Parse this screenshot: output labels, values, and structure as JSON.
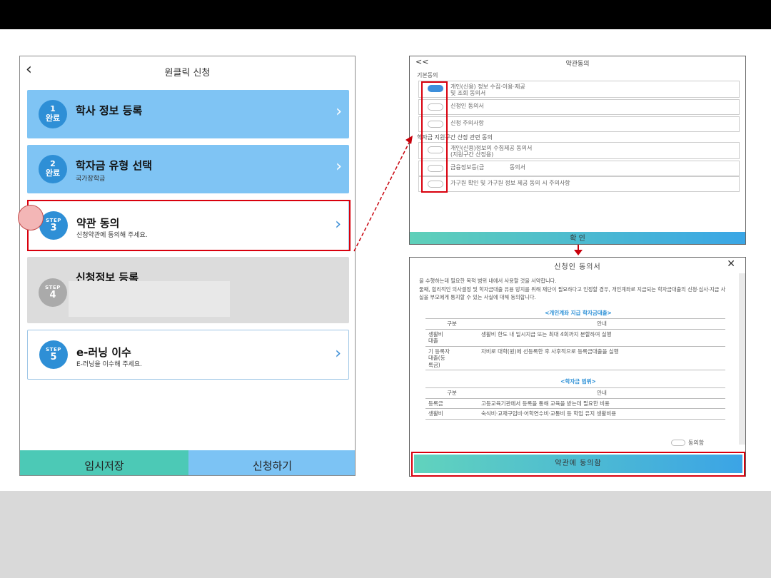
{
  "colors": {
    "highlight": "#d9000d",
    "accent_blue": "#2e8fd6",
    "step_done": "#7fc4f4",
    "teal": "#4cc9b6"
  },
  "phone": {
    "title": "원클릭 신청",
    "steps": [
      {
        "num": "1",
        "tag": "완료",
        "title": "학사 정보 등록",
        "sub": ""
      },
      {
        "num": "2",
        "tag": "완료",
        "title": "학자금 유형 선택",
        "sub": "국가장학금"
      },
      {
        "num": "3",
        "tag": "STEP",
        "title": "약관 동의",
        "sub": "신청약관에 동의해 주세요."
      },
      {
        "num": "4",
        "tag": "STEP",
        "title": "신청정보 등록",
        "sub": ""
      },
      {
        "num": "5",
        "tag": "STEP",
        "title": "e-러닝 이수",
        "sub": "E-러닝을 이수해 주세요."
      }
    ],
    "save_label": "임시저장",
    "apply_label": "신청하기"
  },
  "terms": {
    "back": "<<",
    "title": "약관동의",
    "section1": "기본동의",
    "section2": "학자금 지원구간 산정 관련 동의",
    "items": [
      "개인(신용) 정보 수집·이용·제공\n및 조회 동의서",
      "신청인 동의서",
      "신청 주의사항",
      "개인(신용)정보의 수집제공 동의서\n(지원구간 산정용)",
      "금융정보등(금              동의서",
      "가구원 확인 및 가구원 정보 제공 동의 시 주의사항"
    ],
    "confirm_label": "확 인"
  },
  "consent": {
    "title": "신청인 동의서",
    "para1": "을 수행하는데 필요한 목적 범위 내에서 사용할 것을 서약합니다.",
    "para2": "둘째, 합리적인 의사결정 및 학자금대출 유용 방지를 위해 재단이 필요하다고 인정할 경우, 개인계좌로 지급되는 학자금대출의 신청·심사·지급 사실을 부모에게 통지할 수 있는 사실에 대해 동의합니다.",
    "sub1": "<개인계좌 지급 학자금대출>",
    "table1_head": [
      "구분",
      "안내"
    ],
    "table1": [
      [
        "생활비\n대출",
        "생활비 한도 내 일시지급 또는 최대 4회까지 분할하여 실행"
      ],
      [
        "기 등록자\n대출(등\n록금)",
        "자비로 대학(원)에 선등록한 후 사후적으로 등록금대출을 실행"
      ]
    ],
    "sub2": "<학자금 범위>",
    "table2_head": [
      "구분",
      "안내"
    ],
    "table2": [
      [
        "등록금",
        "고등교육기관에서 등록을 통해 교육을 받는데 필요한 비용"
      ],
      [
        "생활비",
        "숙식비·교재구입비·어학연수비·교통비 등 학업 유지 생활비용"
      ]
    ],
    "agree_label": "동의함",
    "button_label": "약관에 동의함"
  }
}
